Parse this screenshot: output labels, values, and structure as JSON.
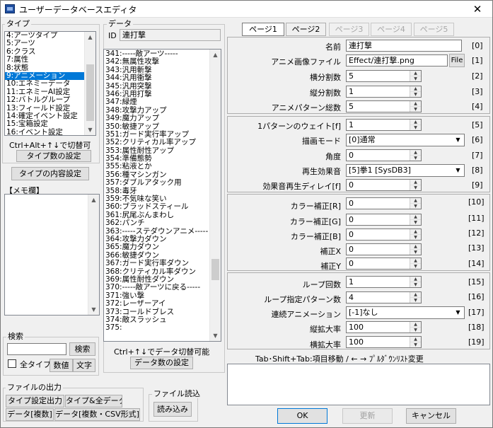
{
  "window": {
    "title": "ユーザーデータベースエディタ",
    "close_glyph": "✕"
  },
  "type_group": {
    "title": "タイプ",
    "items": [
      "4:アーツタイプ",
      "5:アーツ",
      "6:クラス",
      "7:属性",
      "8:状態",
      "9:アニメーション",
      "10:エネミーデータ",
      "11:エネミーAI設定",
      "12:バトルグループ",
      "13:フィールド設定",
      "14:確定イベント設定",
      "15:宝箱設定",
      "16:イベント設定"
    ],
    "selected_index": 5,
    "hint": "Ctrl+Alt+↑↓で切替可",
    "count_button": "タイプ数の設定"
  },
  "type_content_button": "タイプの内容設定",
  "memo": {
    "title": "【メモ欄】"
  },
  "search": {
    "title": "検索",
    "button": "検索",
    "all_types": "全タイプ",
    "numeric": "数値",
    "text": "文字"
  },
  "file_output": {
    "title": "ファイルの出力",
    "b1": "タイプ設定出力",
    "b2": "タイプ&全データ",
    "b3": "データ[複数]",
    "b4": "データ[複数・CSV形式]"
  },
  "file_read": {
    "title": "ファイル読込",
    "button": "読み込み"
  },
  "data_group": {
    "title": "データ",
    "id_label": "ID",
    "id_value": "連打撃",
    "items": [
      "341:-----敵アーツ-----",
      "342:無属性攻撃",
      "343:汎用斬撃",
      "344:汎用衝撃",
      "345:汎用突撃",
      "346:汎用打撃",
      "347:緑煙",
      "348:攻撃力アップ",
      "349:魔力アップ",
      "350:敏捷アップ",
      "351:ガード実行率アップ",
      "352:クリティカル率アップ",
      "353:属性耐性アップ",
      "354:準備態勢",
      "355:粘液とか",
      "356:種マシンガン",
      "357:ダブルアタック用",
      "358:毒牙",
      "359:不気味な笑い",
      "360:ブラッドスティール",
      "361:尻尾ぶんまわし",
      "362:パンチ",
      "363:-----ステダウンアニメ-----",
      "364:攻撃力ダウン",
      "365:魔力ダウン",
      "366:敏捷ダウン",
      "367:ガード実行率ダウン",
      "368:クリティカル率ダウン",
      "369:属性耐性ダウン",
      "370:-----敵アーツに戻る-----",
      "371:強い撃",
      "372:レーザーアイ",
      "373:コールドブレス",
      "374:敵スラッシュ",
      "375:"
    ],
    "hint": "Ctrl+↑↓でデータ切替可能",
    "count_button": "データ数の設定"
  },
  "tabs": [
    {
      "label": "ページ1",
      "state": "active"
    },
    {
      "label": "ページ2",
      "state": "normal"
    },
    {
      "label": "ページ3",
      "state": "disabled"
    },
    {
      "label": "ページ4",
      "state": "disabled"
    },
    {
      "label": "ページ5",
      "state": "disabled"
    }
  ],
  "fields": {
    "name": {
      "label": "名前",
      "value": "連打撃",
      "idx": "[0]"
    },
    "anim_file": {
      "label": "アニメ画像ファイル",
      "value": "Effect/連打撃.png",
      "button": "File",
      "idx": "[1]"
    },
    "h_div": {
      "label": "横分割数",
      "value": "5",
      "idx": "[2]"
    },
    "v_div": {
      "label": "縦分割数",
      "value": "1",
      "idx": "[3]"
    },
    "pattern_total": {
      "label": "アニメパターン総数",
      "value": "5",
      "idx": "[4]"
    },
    "wait": {
      "label": "1パターンのウェイト[f]",
      "value": "1",
      "idx": "[5]"
    },
    "draw_mode": {
      "label": "描画モード",
      "value": "[0]通常",
      "idx": "[6]"
    },
    "angle": {
      "label": "角度",
      "value": "0",
      "idx": "[7]"
    },
    "sound": {
      "label": "再生効果音",
      "value": "[5]拳1 [SysDB3]",
      "idx": "[8]"
    },
    "sound_delay": {
      "label": "効果音再生ディレイ[f]",
      "value": "0",
      "idx": "[9]"
    },
    "color_r": {
      "label": "カラー補正[R]",
      "value": "0",
      "idx": "[10]"
    },
    "color_g": {
      "label": "カラー補正[G]",
      "value": "0",
      "idx": "[11]"
    },
    "color_b": {
      "label": "カラー補正[B]",
      "value": "0",
      "idx": "[12]"
    },
    "offset_x": {
      "label": "補正X",
      "value": "0",
      "idx": "[13]"
    },
    "offset_y": {
      "label": "補正Y",
      "value": "0",
      "idx": "[14]"
    },
    "loop_count": {
      "label": "ループ回数",
      "value": "1",
      "idx": "[15]"
    },
    "loop_pattern": {
      "label": "ループ指定パターン数",
      "value": "4",
      "idx": "[16]"
    },
    "chain_anim": {
      "label": "連続アニメーション",
      "value": "[-1]なし",
      "idx": "[17]"
    },
    "v_scale": {
      "label": "縦拡大率",
      "value": "100",
      "idx": "[18]"
    },
    "h_scale": {
      "label": "横拡大率",
      "value": "100",
      "idx": "[19]"
    }
  },
  "help_text": "Tab･Shift+Tab:項目移動 / ← → ﾌﾟﾙﾀﾞｳﾝﾘｽﾄ変更",
  "footer": {
    "ok": "OK",
    "update": "更新",
    "cancel": "キャンセル"
  }
}
